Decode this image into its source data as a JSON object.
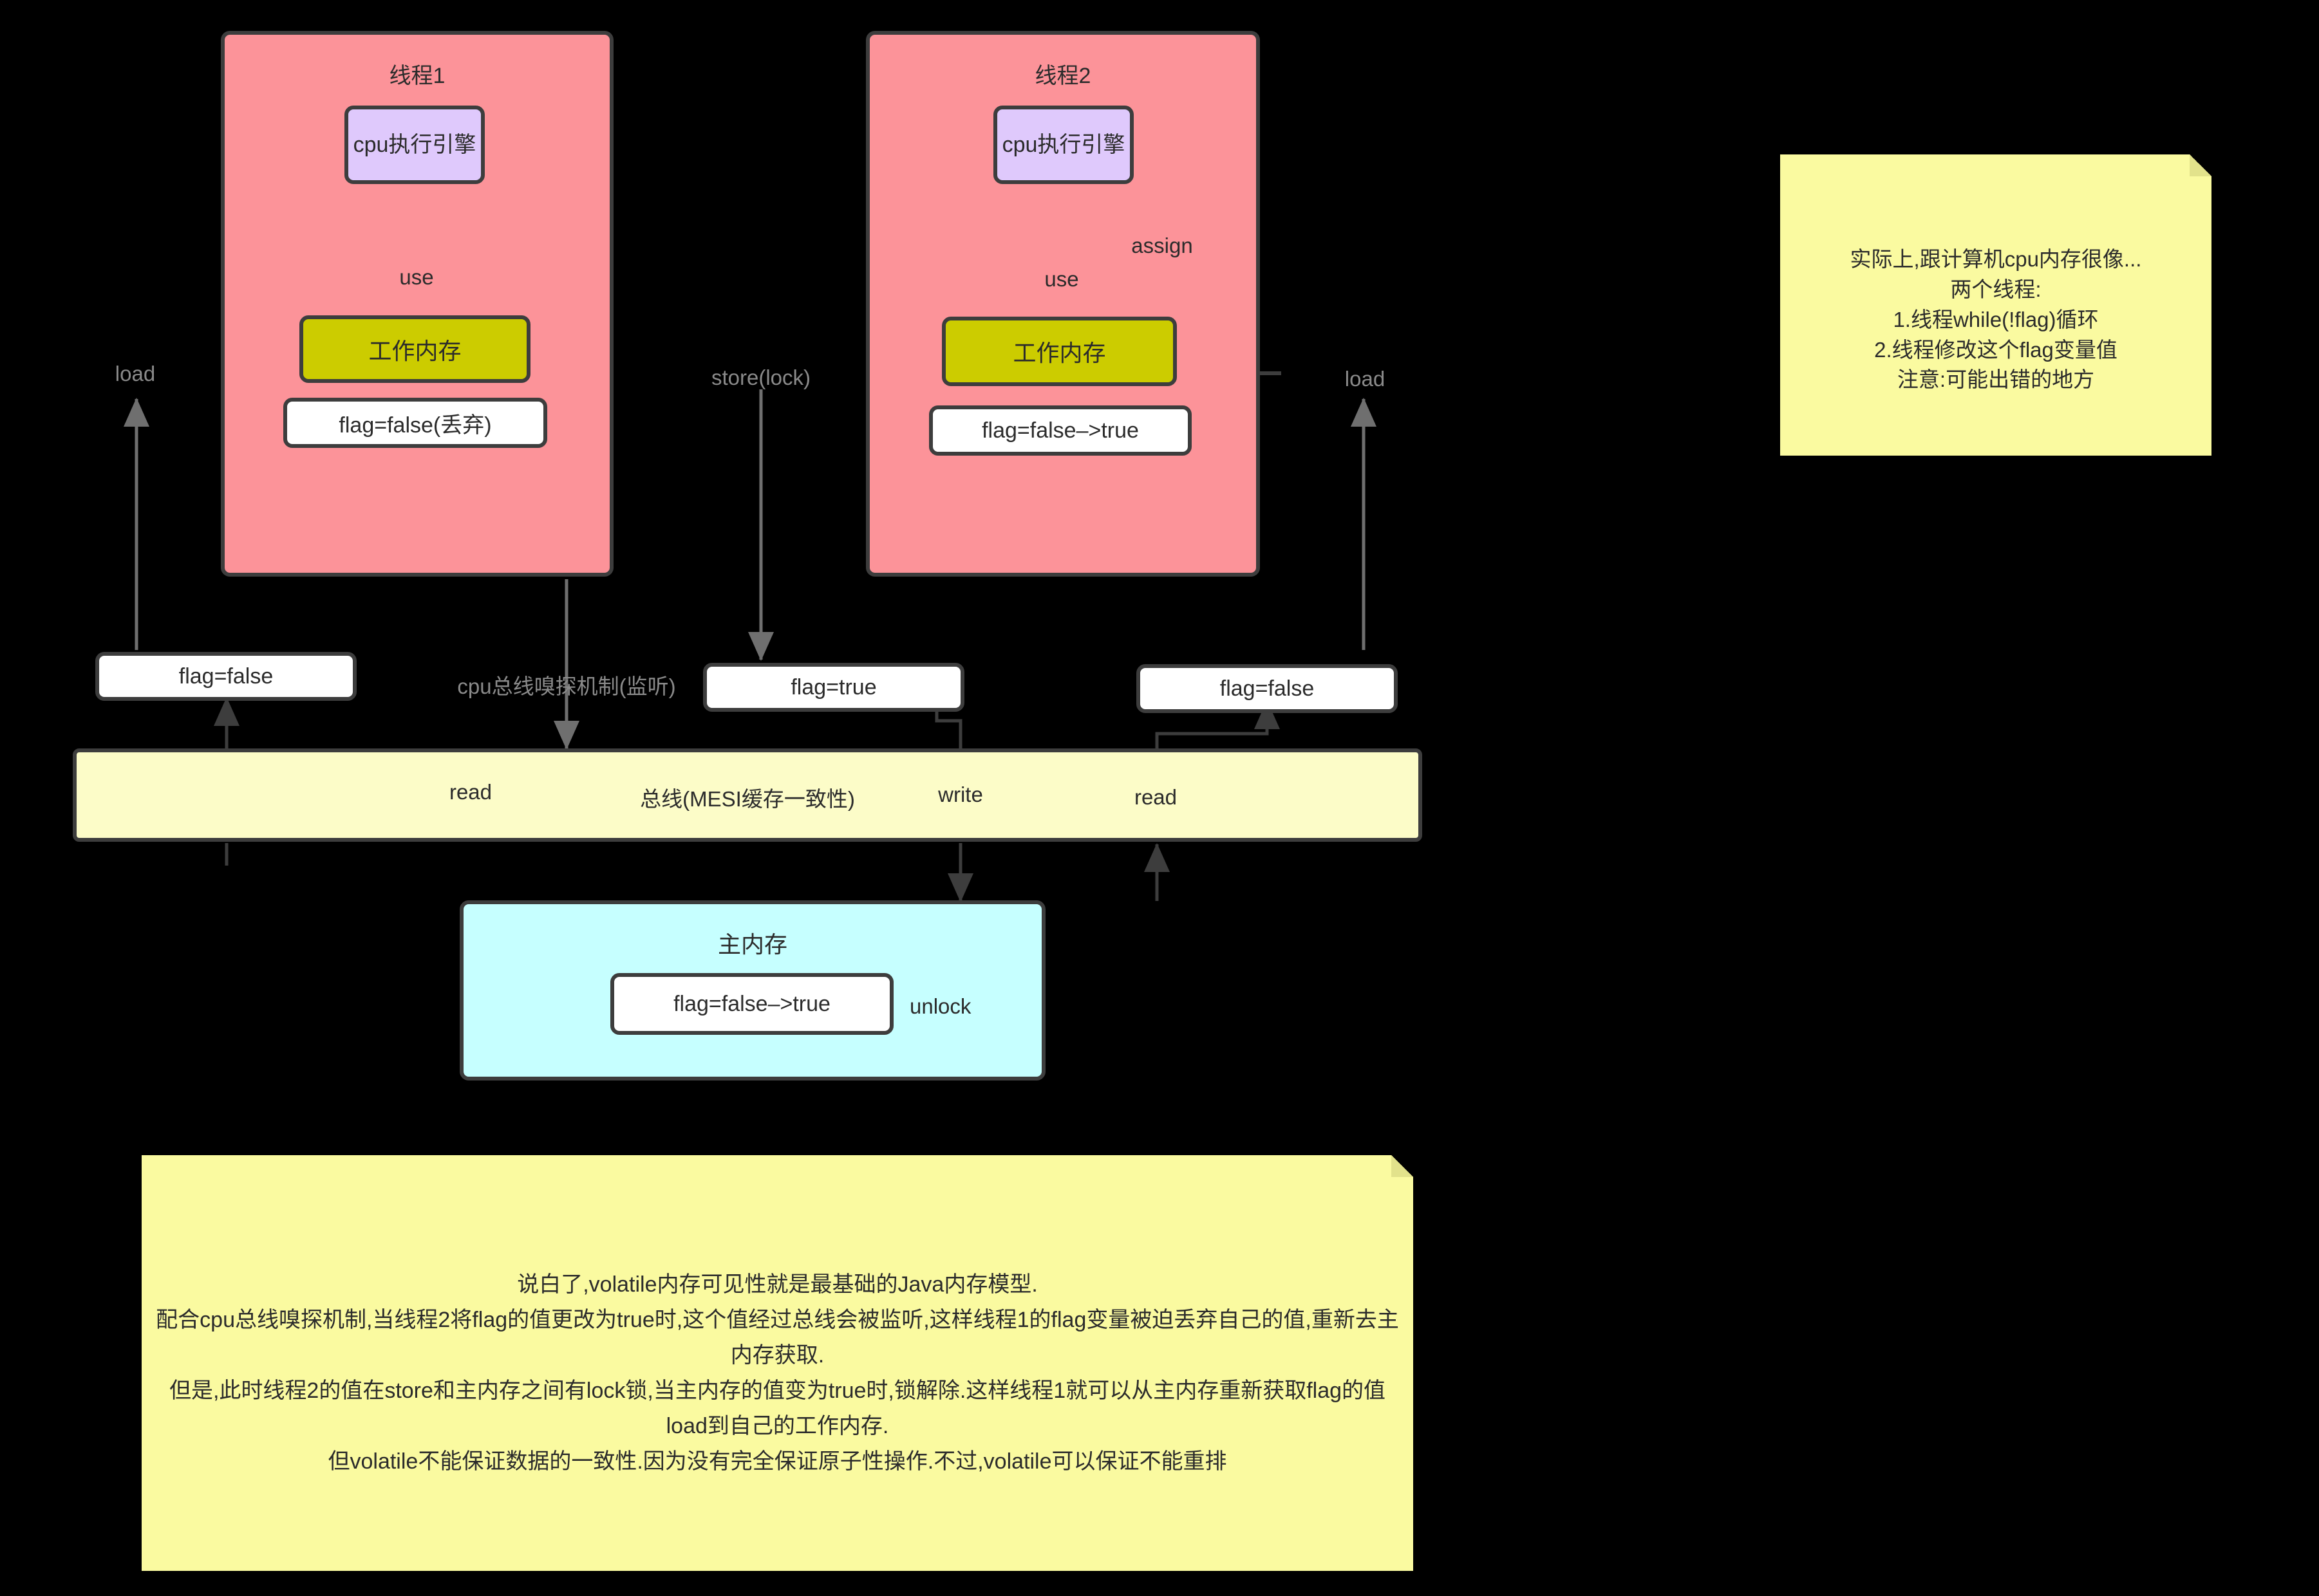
{
  "diagram": {
    "title": "Java volatile memory visibility (JMM) diagram",
    "colors": {
      "thread_fill": "#FC9399",
      "cpu_fill": "#DFC9FC",
      "working_memory_fill": "#CCCC00",
      "bus_fill": "#FCFCC8",
      "main_memory_fill": "#C6FFFF",
      "note_fill": "#FAFAA0",
      "stroke": "#3d3d3d",
      "muted_label": "#8a8a8a",
      "background": "#000000"
    }
  },
  "thread1": {
    "title": "线程1",
    "cpu_label": "cpu执行引擎",
    "working_memory_label": "工作内存",
    "value_label": "flag=false(丢弃)",
    "use_label": "use"
  },
  "thread2": {
    "title": "线程2",
    "cpu_label": "cpu执行引擎",
    "working_memory_label": "工作内存",
    "value_label": "flag=false–>true",
    "use_label": "use",
    "assign_label": "assign"
  },
  "edge_labels": {
    "load_left": "load",
    "store_lock": "store(lock)",
    "load_right": "load",
    "snoop": "cpu总线嗅探机制(监听)",
    "read_left": "read",
    "write": "write",
    "read_right": "read",
    "unlock": "unlock"
  },
  "cache_values": {
    "left": "flag=false",
    "middle": "flag=true",
    "right": "flag=false"
  },
  "bus": {
    "label": "总线(MESI缓存一致性)"
  },
  "main_memory": {
    "title": "主内存",
    "value_label": "flag=false–>true"
  },
  "note_top_right": {
    "text": "实际上,跟计算机cpu内存很像...\n两个线程:\n1.线程while(!flag)循环\n2.线程修改这个flag变量值\n注意:可能出错的地方"
  },
  "note_bottom": {
    "text": "说白了,volatile内存可见性就是最基础的Java内存模型.\n配合cpu总线嗅探机制,当线程2将flag的值更改为true时,这个值经过总线会被监听,这样线程1的flag变量被迫丢弃自己的值,重新去主内存获取.\n但是,此时线程2的值在store和主内存之间有lock锁,当主内存的值变为true时,锁解除.这样线程1就可以从主内存重新获取flag的值load到自己的工作内存.\n但volatile不能保证数据的一致性.因为没有完全保证原子性操作.不过,volatile可以保证不能重排"
  }
}
